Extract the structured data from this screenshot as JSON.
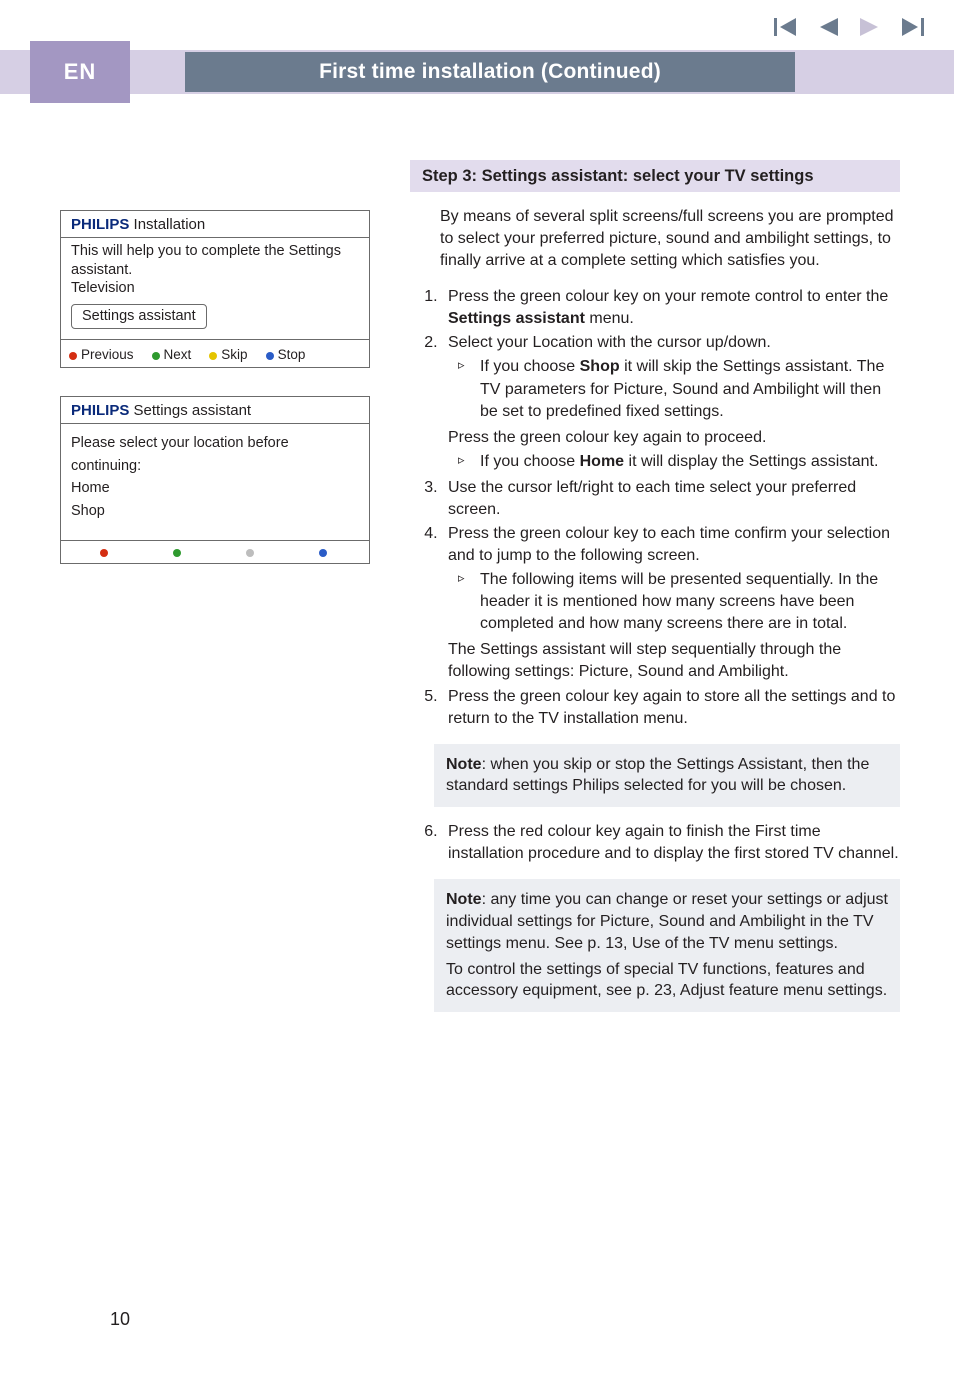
{
  "lang_tab": "EN",
  "title_bar": "First time installation   (Continued)",
  "nav": {
    "first_icon": "nav-first-icon",
    "prev_icon": "nav-prev-icon",
    "next_icon": "nav-next-icon",
    "last_icon": "nav-last-icon"
  },
  "osd1": {
    "brand": "PHILIPS",
    "title": " Installation",
    "body_line1": "This will help you to complete the Settings assistant.",
    "body_line2": "Television",
    "button": "Settings assistant",
    "foot_previous": "Previous",
    "foot_next": "Next",
    "foot_skip": "Skip",
    "foot_stop": "Stop"
  },
  "osd2": {
    "brand": "PHILIPS",
    "title": " Settings assistant",
    "body_line1": "Please select your location before continuing:",
    "opt_home": "Home",
    "opt_shop": "Shop"
  },
  "right": {
    "step_strip": "Step 3: Settings assistant: select your TV settings",
    "intro": "By means of several split screens/full screens you are prompted to select your preferred picture, sound and ambilight settings, to finally arrive at a complete setting which satisfies you.",
    "li1": "Press the green colour key on your remote control to enter the ",
    "li1_bold": "Settings assistant",
    "li1_tail": " menu.",
    "li2": "Select your Location with the cursor up/down.",
    "li2_sub1a": "If you choose ",
    "li2_sub1bold": "Shop",
    "li2_sub1b": " it will skip the Settings assistant. The TV parameters for Picture, Sound and Ambilight will then be set to predefined fixed settings.",
    "li2_after": "Press the green colour key again to proceed.",
    "li2_sub2a": "If you choose ",
    "li2_sub2bold": "Home",
    "li2_sub2b": " it will display the Settings assistant.",
    "li3": "Use the cursor left/right to each time select your preferred screen.",
    "li4": "Press the green colour key to each time confirm your selection and to jump to the following screen.",
    "li4_sub": "The following items will be presented sequentially. In the header it is mentioned how many screens have been completed and how many screens there are in total.",
    "li4_after": "The Settings assistant will step sequentially through the following settings: Picture, Sound and Ambilight.",
    "li5": "Press the green colour key again to store all the settings and to return to the TV installation menu.",
    "note1_bold": "Note",
    "note1": ": when you skip or stop the Settings Assistant, then the standard settings Philips selected for you will be chosen.",
    "li6": "Press the red colour key again to finish the First time installation procedure and to display the first stored TV channel.",
    "note2_bold": "Note",
    "note2a": ": any time you can change or reset your settings or adjust individual settings for Picture, Sound and Ambilight in the TV settings menu. See p. 13, Use of the TV menu settings.",
    "note2b": "To control the settings of special TV functions, features and accessory equipment, see p. 23,  Adjust feature menu settings."
  },
  "page_number": "10"
}
